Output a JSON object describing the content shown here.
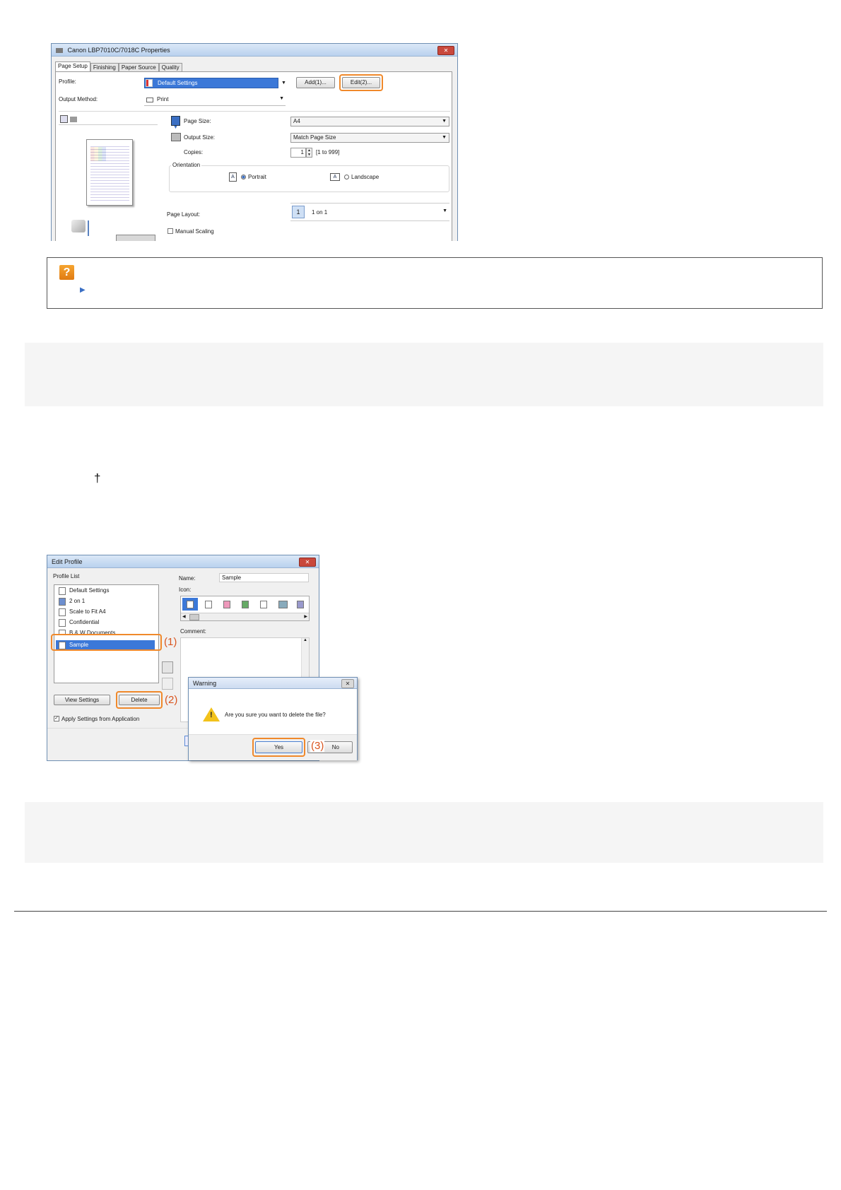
{
  "properties_dialog": {
    "title": "Canon LBP7010C/7018C Properties",
    "tabs": [
      "Page Setup",
      "Finishing",
      "Paper Source",
      "Quality"
    ],
    "profile_label": "Profile:",
    "profile_value": "Default Settings",
    "add_button": "Add(1)...",
    "edit_button": "Edit(2)...",
    "output_method_label": "Output Method:",
    "output_method_value": "Print",
    "page_size_label": "Page Size:",
    "page_size_value": "A4",
    "output_size_label": "Output Size:",
    "output_size_value": "Match Page Size",
    "copies_label": "Copies:",
    "copies_value": "1",
    "copies_range": "[1 to 999]",
    "orientation_label": "Orientation",
    "portrait_label": "Portrait",
    "landscape_label": "Landscape",
    "page_layout_label": "Page Layout:",
    "page_layout_value": "1 on 1",
    "page_layout_number": "1",
    "manual_scaling_label": "Manual Scaling"
  },
  "edit_profile_dialog": {
    "title": "Edit Profile",
    "profile_list_label": "Profile List",
    "profiles": [
      "Default Settings",
      "2 on 1",
      "Scale to Fit A4",
      "Confidential",
      "B & W Documents",
      "Sample"
    ],
    "name_label": "Name:",
    "name_value": "Sample",
    "icon_label": "Icon:",
    "comment_label": "Comment:",
    "view_settings_button": "View Settings",
    "delete_button": "Delete",
    "apply_settings_label": "Apply Settings from Application"
  },
  "warning_dialog": {
    "title": "Warning",
    "message": "Are you sure you want to delete the file?",
    "yes_button": "Yes",
    "no_button": "No"
  },
  "markers": [
    "(1)",
    "(2)",
    "(3)"
  ],
  "colors": {
    "highlight": "#f0892b",
    "selection": "#3b78d8",
    "panel": "#f5f5f5"
  }
}
